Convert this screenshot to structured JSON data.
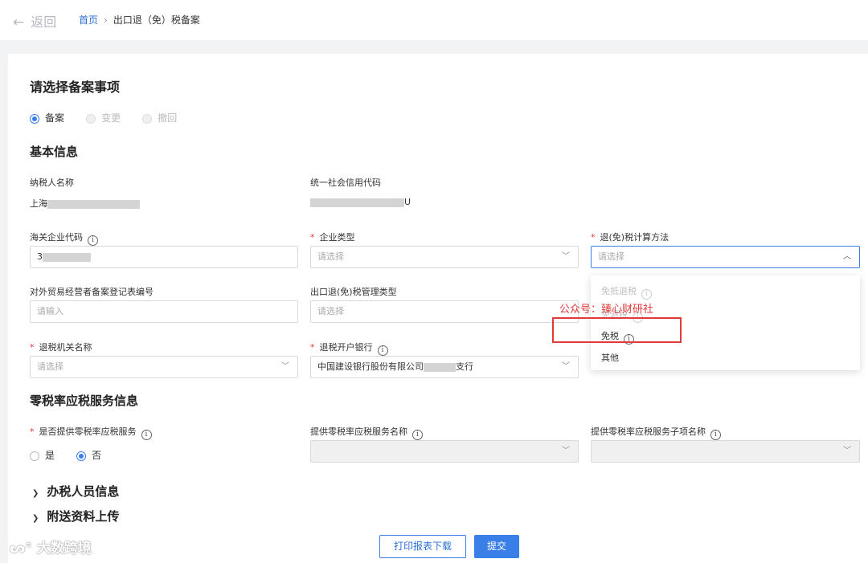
{
  "topbar": {
    "back_label": "返回",
    "breadcrumb_home": "首页",
    "breadcrumb_current": "出口退（免）税备案"
  },
  "section_filing": {
    "title": "请选择备案事项",
    "options": [
      {
        "label": "备案",
        "selected": true
      },
      {
        "label": "变更",
        "disabled": true
      },
      {
        "label": "撤回",
        "disabled": true
      }
    ]
  },
  "section_basic": {
    "title": "基本信息",
    "taxpayer_name_label": "纳税人名称",
    "taxpayer_name_value": "上海",
    "credit_code_label": "统一社会信用代码",
    "credit_code_value": "U",
    "customs_code_label": "海关企业代码",
    "customs_code_value": "3",
    "enterprise_type_label": "企业类型",
    "enterprise_type_placeholder": "请选择",
    "calc_method_label": "退(免)税计算方法",
    "calc_method_placeholder": "请选择",
    "trade_reg_label": "对外贸易经营者备案登记表编号",
    "trade_reg_placeholder": "请输入",
    "mgmt_type_label": "出口退(免)税管理类型",
    "mgmt_type_placeholder": "请选择",
    "tax_authority_label": "退税机关名称",
    "tax_authority_placeholder": "请选择",
    "bank_label": "退税开户银行",
    "bank_value_prefix": "中国建设银行股份有限公司",
    "bank_value_suffix": "支行"
  },
  "calc_method_dropdown": {
    "options": [
      {
        "label": "免抵退税",
        "disabled": true
      },
      {
        "label": "免退税",
        "disabled": true
      },
      {
        "label": "免税",
        "highlighted": true
      },
      {
        "label": "其他"
      }
    ]
  },
  "watermark": "公众号：臻心财研社",
  "section_zero_rate": {
    "title": "零税率应税服务信息",
    "provide_label": "是否提供零税率应税服务",
    "provide_options": [
      {
        "label": "是",
        "selected": false
      },
      {
        "label": "否",
        "selected": true
      }
    ],
    "service_name_label": "提供零税率应税服务名称",
    "sub_service_label": "提供零税率应税服务子项名称"
  },
  "collapsed_sections": [
    {
      "label": "办税人员信息"
    },
    {
      "label": "附送资料上传"
    }
  ],
  "footer": {
    "print_label": "打印报表下载",
    "submit_label": "提交"
  },
  "logo_text": "大数跨境",
  "colors": {
    "primary": "#3a7ee8",
    "required": "#e4393c",
    "highlight_box": "#e03a3a"
  },
  "icons": [
    "back-arrow-icon",
    "chevron-down-icon",
    "chevron-up-icon",
    "info-icon",
    "chevron-right-icon"
  ]
}
